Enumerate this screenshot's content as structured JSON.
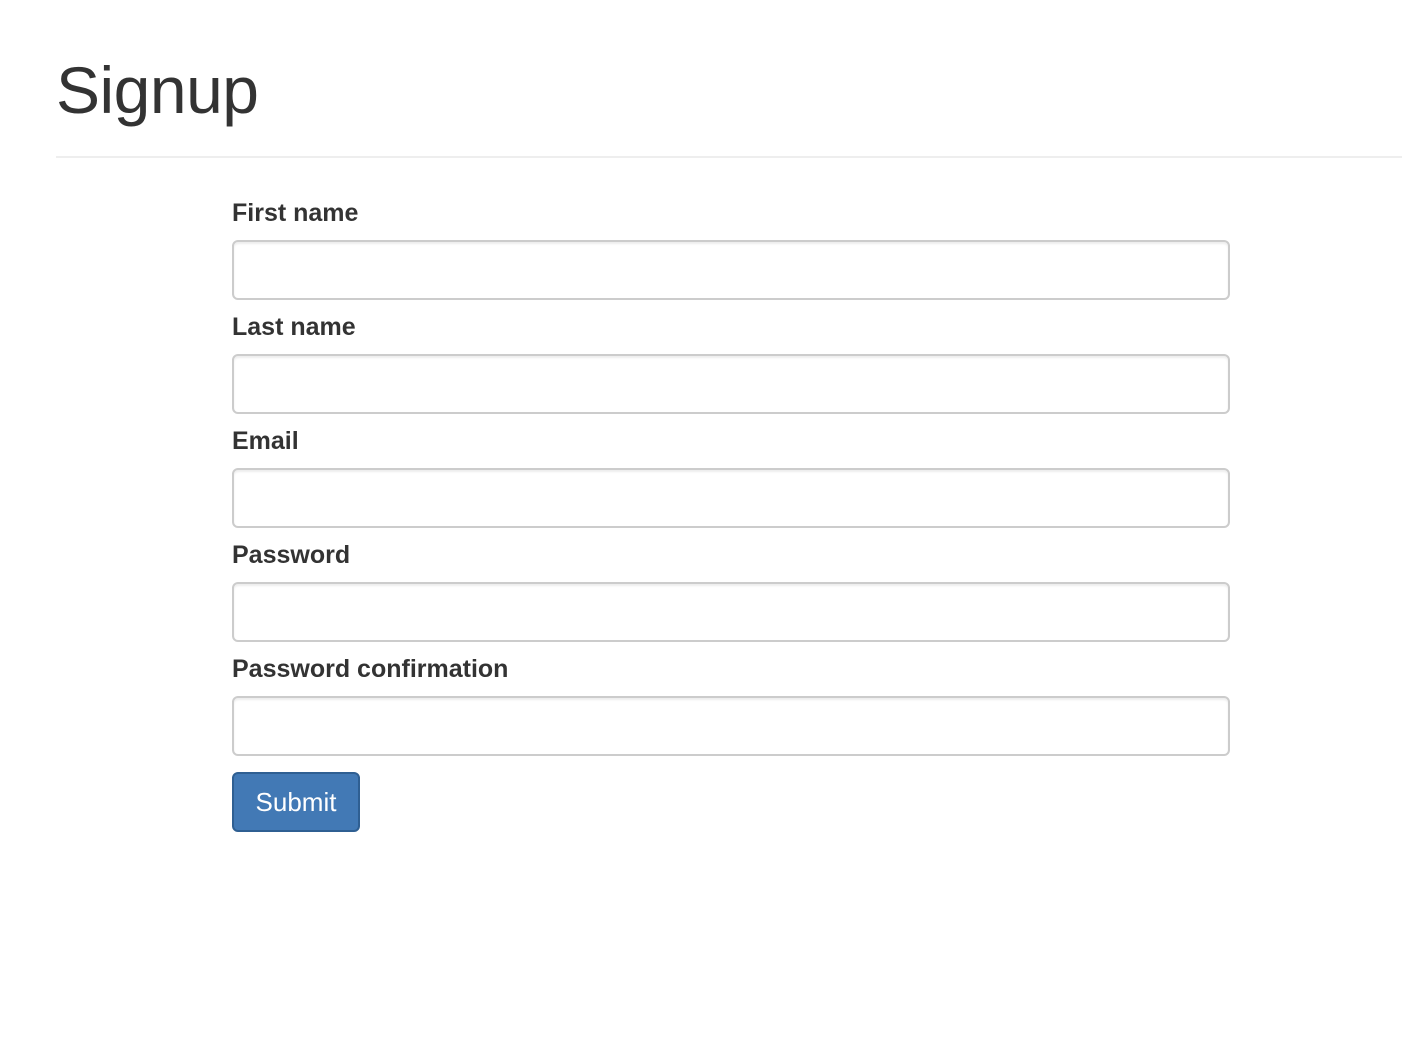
{
  "page": {
    "title": "Signup"
  },
  "form": {
    "fields": [
      {
        "label": "First name",
        "value": "",
        "type": "text"
      },
      {
        "label": "Last name",
        "value": "",
        "type": "text"
      },
      {
        "label": "Email",
        "value": "",
        "type": "email"
      },
      {
        "label": "Password",
        "value": "",
        "type": "password"
      },
      {
        "label": "Password confirmation",
        "value": "",
        "type": "password"
      }
    ],
    "submit_label": "Submit"
  },
  "colors": {
    "text": "#333333",
    "primary_button": "#4279b5",
    "input_border": "#cccccc",
    "divider": "#eeeeee"
  }
}
